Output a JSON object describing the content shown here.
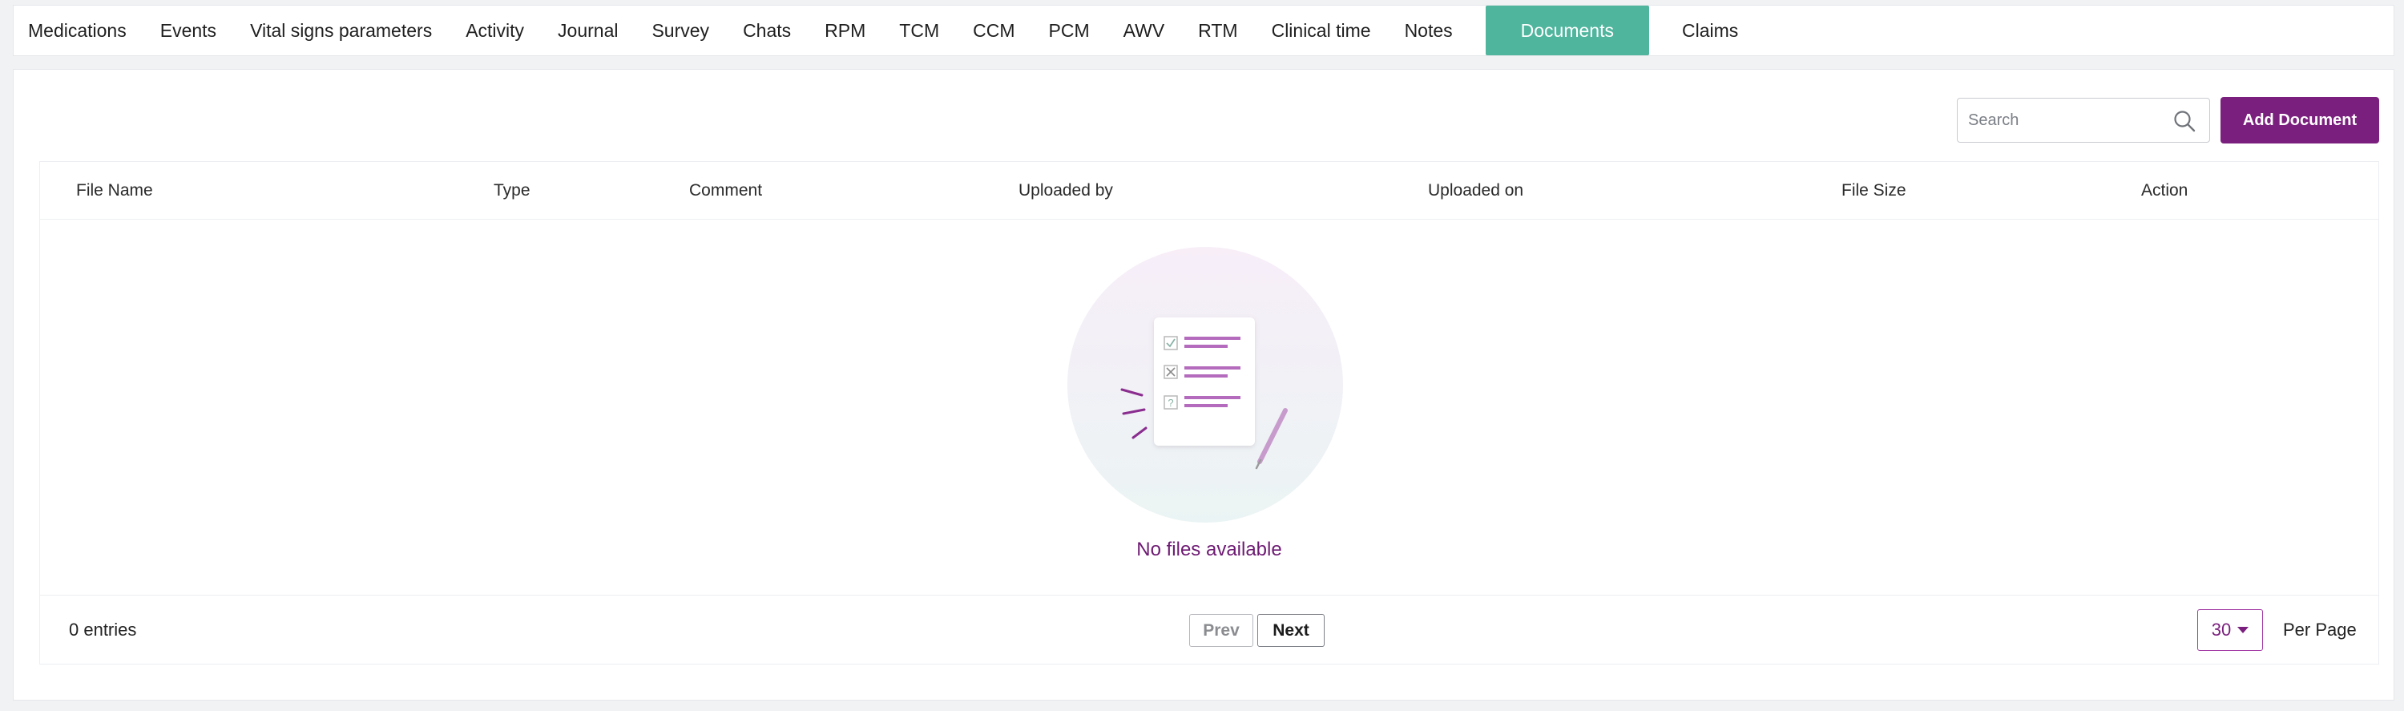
{
  "tabs": [
    {
      "label": "Medications",
      "active": false
    },
    {
      "label": "Events",
      "active": false
    },
    {
      "label": "Vital signs parameters",
      "active": false
    },
    {
      "label": "Activity",
      "active": false
    },
    {
      "label": "Journal",
      "active": false
    },
    {
      "label": "Survey",
      "active": false
    },
    {
      "label": "Chats",
      "active": false
    },
    {
      "label": "RPM",
      "active": false
    },
    {
      "label": "TCM",
      "active": false
    },
    {
      "label": "CCM",
      "active": false
    },
    {
      "label": "PCM",
      "active": false
    },
    {
      "label": "AWV",
      "active": false
    },
    {
      "label": "RTM",
      "active": false
    },
    {
      "label": "Clinical time",
      "active": false
    },
    {
      "label": "Notes",
      "active": false
    },
    {
      "label": "Documents",
      "active": true
    },
    {
      "label": "Claims",
      "active": false
    }
  ],
  "toolbar": {
    "search_placeholder": "Search",
    "add_button_label": "Add Document"
  },
  "table": {
    "columns": [
      "File Name",
      "Type",
      "Comment",
      "Uploaded by",
      "Uploaded on",
      "File Size",
      "Action"
    ],
    "rows": [],
    "empty_message": "No files available"
  },
  "footer": {
    "entries_text": "0 entries",
    "prev_label": "Prev",
    "next_label": "Next",
    "per_page_value": "30",
    "per_page_label": "Per Page"
  },
  "colors": {
    "active_tab": "#4fb59d",
    "primary": "#7a1f7d",
    "empty_text": "#6e1b73"
  },
  "icons": {
    "search": "search-icon",
    "dropdown": "caret-down-icon",
    "empty_state": "empty-documents-illustration"
  }
}
